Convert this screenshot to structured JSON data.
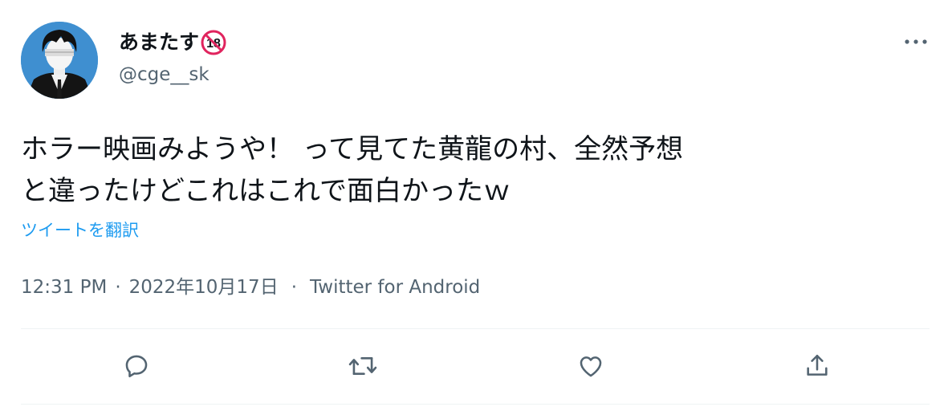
{
  "author": {
    "display_name": "あまたす",
    "handle": "@cge__sk",
    "age_badge_text": "18"
  },
  "tweet": {
    "text": "ホラー映画みようや！ って見てた黄龍の村、全然予想\nと違ったけどこれはこれで面白かったｗ",
    "translate_label": "ツイートを翻訳"
  },
  "meta": {
    "time": "12:31 PM",
    "separator": "·",
    "date": "2022年10月17日",
    "source_separator": "·",
    "source": "Twitter for Android"
  },
  "actions": {
    "icons": [
      "reply-icon",
      "retweet-icon",
      "like-icon",
      "share-icon"
    ]
  },
  "colors": {
    "accent": "#1d9bf0",
    "secondary_text": "#536471",
    "divider": "#eff3f4",
    "badge_red": "#e0245e"
  }
}
